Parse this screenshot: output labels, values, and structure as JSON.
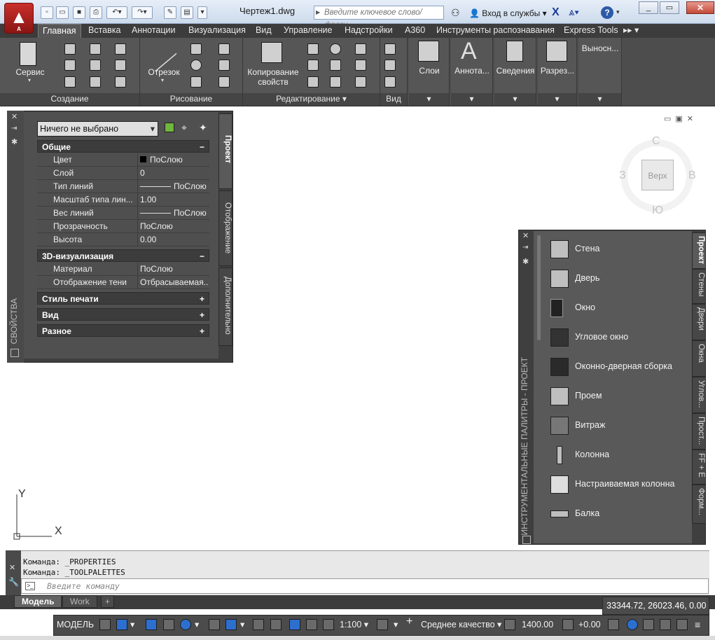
{
  "app": {
    "logo_letter": "A",
    "doc_title": "Чертеж1.dwg",
    "search_placeholder": "Введите ключевое слово/фразу",
    "signin": "Вход в службы"
  },
  "tabs": [
    "Главная",
    "Вставка",
    "Аннотации",
    "Визуализация",
    "Вид",
    "Управление",
    "Надстройки",
    "A360",
    "Инструменты распознавания",
    "Express Tools"
  ],
  "ribbon": {
    "service": "Сервис",
    "line": "Отрезок",
    "match_props": "Копирование\nсвойств",
    "layers": "Слои",
    "annot": "Аннота...",
    "info": "Сведения",
    "section": "Разрез...",
    "callout": "Выносн...",
    "panels": {
      "create": "Создание",
      "draw": "Рисование",
      "modify": "Редактирование",
      "view": "Вид"
    }
  },
  "viewcube": {
    "top": "Верх",
    "n": "С",
    "s": "Ю",
    "w": "З",
    "e": "В"
  },
  "properties": {
    "select": "Ничего не выбрано",
    "palette_title": "СВОЙСТВА",
    "tabs": [
      "Проект",
      "Отображение",
      "Дополнительно"
    ],
    "general": "Общие",
    "rows1": [
      {
        "name": "Цвет",
        "value": "ПоСлою"
      },
      {
        "name": "Слой",
        "value": "0"
      },
      {
        "name": "Тип линий",
        "value": "ПоСлою"
      },
      {
        "name": "Масштаб типа лин...",
        "value": "1.00"
      },
      {
        "name": "Вес линий",
        "value": "ПоСлою"
      },
      {
        "name": "Прозрачность",
        "value": "ПоСлою"
      },
      {
        "name": "Высота",
        "value": "0.00"
      }
    ],
    "viz": "3D-визуализация",
    "rows2": [
      {
        "name": "Материал",
        "value": "ПоСлою"
      },
      {
        "name": "Отображение тени",
        "value": "Отбрасываемая..."
      }
    ],
    "collapsed": [
      "Стиль печати",
      "Вид",
      "Разное"
    ]
  },
  "toolpalette": {
    "title": "ИНСТРУМЕНТАЛЬНЫЕ ПАЛИТРЫ - ПРОЕКТ",
    "tabs": [
      "Проект",
      "Стены",
      "Двери",
      "Окна",
      "Углов...",
      "Прост...",
      "FF + E",
      "Форм..."
    ],
    "items": [
      "Стена",
      "Дверь",
      "Окно",
      "Угловое окно",
      "Оконно-дверная сборка",
      "Проем",
      "Витраж",
      "Колонна",
      "Настраиваемая колонна",
      "Балка"
    ]
  },
  "ucs": {
    "x": "X",
    "y": "Y"
  },
  "command": {
    "line1": "Команда:  _PROPERTIES",
    "line2": "Команда:  _TOOLPALETTES",
    "placeholder": "Введите команду"
  },
  "layouts": [
    "Модель",
    "Work"
  ],
  "status": {
    "coords": "33344.72, 26023.46, 0.00",
    "model": "МОДЕЛЬ",
    "scale": "1:100",
    "quality": "Среднее качество",
    "elev": "1400.00",
    "offset": "+0.00"
  }
}
